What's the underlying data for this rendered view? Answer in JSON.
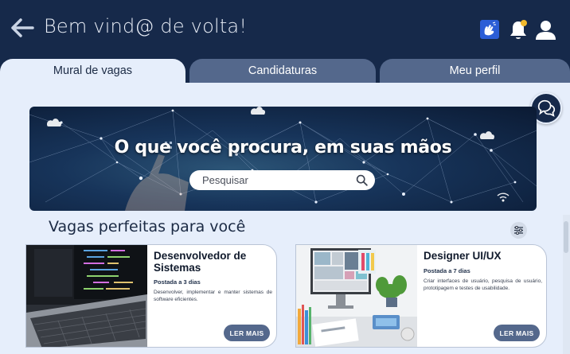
{
  "header": {
    "greeting": "Bem vind@ de volta!",
    "icons": [
      "back-arrow-icon",
      "libras-accessibility-icon",
      "notification-bell-icon",
      "user-profile-icon"
    ],
    "notification_dot_color": "#f1b92d",
    "background_color": "#16294a"
  },
  "tabs": [
    {
      "label": "Mural de vagas",
      "active": true
    },
    {
      "label": "Candidaturas",
      "active": false
    },
    {
      "label": "Meu perfil",
      "active": false
    }
  ],
  "hero": {
    "title": "O que você procura, em suas mãos",
    "search_placeholder": "Pesquisar"
  },
  "section": {
    "title": "Vagas perfeitas para você"
  },
  "jobs": [
    {
      "title": "Desenvolvedor de Sistemas",
      "posted": "Postada a 3 dias",
      "description": "Desenvolver, implementar e manter sistemas de software eficientes.",
      "button": "LER MAIS",
      "image": "laptop-with-code-image"
    },
    {
      "title": "Designer UI/UX",
      "posted": "Postada a 7 dias",
      "description": "Criar interfaces de usuário, pesquisa de usuário, prototipagem e testes de usabilidade.",
      "button": "LER MAIS",
      "image": "designer-desk-image"
    }
  ],
  "colors": {
    "accent": "#54688c",
    "page_background": "#e6eefb"
  }
}
